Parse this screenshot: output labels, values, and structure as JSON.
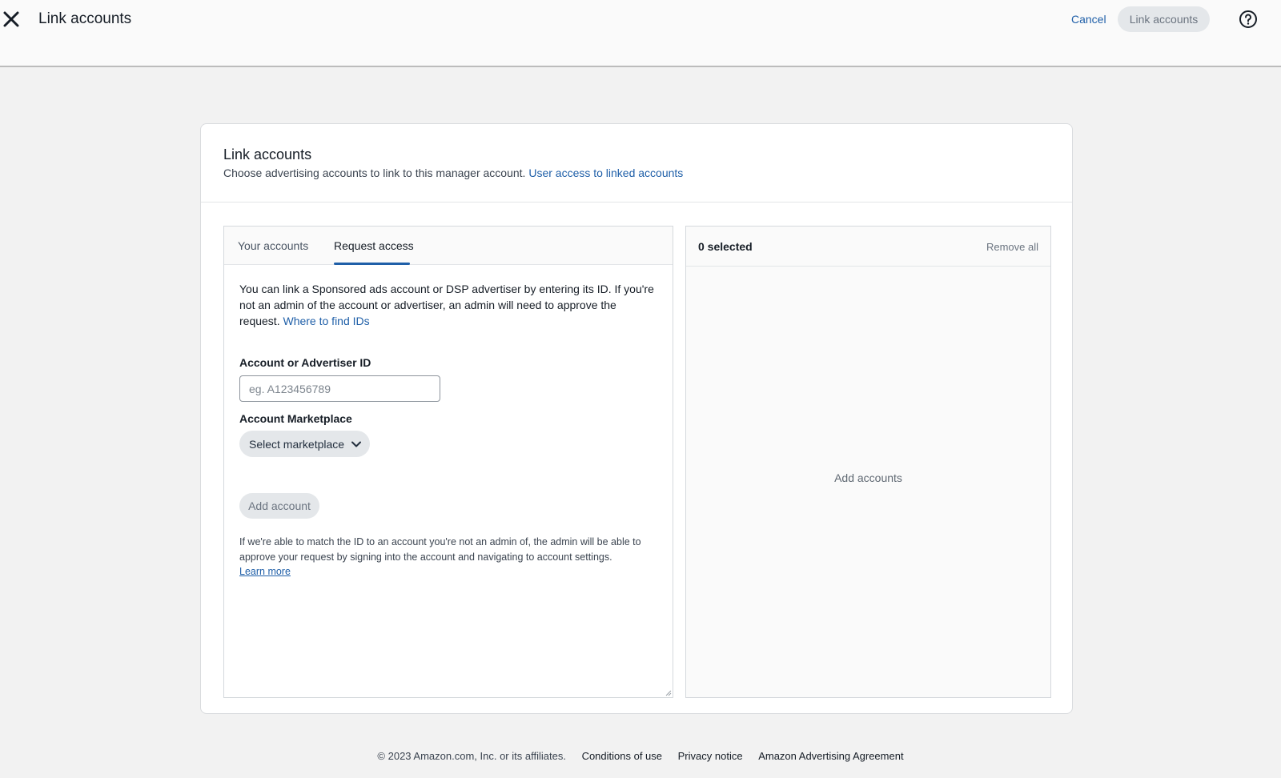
{
  "header": {
    "title": "Link accounts",
    "cancel_label": "Cancel",
    "link_button_label": "Link accounts"
  },
  "card": {
    "title": "Link accounts",
    "subtitle": "Choose advertising accounts to link to this manager account.",
    "subtitle_link": "User access to linked accounts"
  },
  "tabs": [
    {
      "label": "Your accounts",
      "active": false
    },
    {
      "label": "Request access",
      "active": true
    }
  ],
  "request": {
    "intro": "You can link a Sponsored ads account or DSP advertiser by entering its ID. If you're not an admin of the account or advertiser, an admin will need to approve the request.",
    "intro_link": "Where to find IDs",
    "id_label": "Account or Advertiser ID",
    "id_placeholder": "eg. A123456789",
    "id_value": "",
    "marketplace_label": "Account Marketplace",
    "marketplace_value": "Select marketplace",
    "add_button": "Add account",
    "note": "If we're able to match the ID to an account you're not an admin of, the admin will be able to approve your request by signing into the account and navigating to account settings.",
    "note_link": "Learn more"
  },
  "selection": {
    "count_label": "0 selected",
    "remove_all": "Remove all",
    "empty_message": "Add accounts"
  },
  "footer": {
    "copyright": "© 2023 Amazon.com, Inc. or its affiliates.",
    "links": [
      "Conditions of use",
      "Privacy notice",
      "Amazon Advertising Agreement"
    ]
  },
  "colors": {
    "accent": "#1f5fa8",
    "background": "#f2f2f2",
    "disabled_button": "#e4e7ea"
  },
  "icons": [
    "close-icon",
    "help-icon",
    "chevron-down-icon",
    "resize-grip-icon"
  ]
}
